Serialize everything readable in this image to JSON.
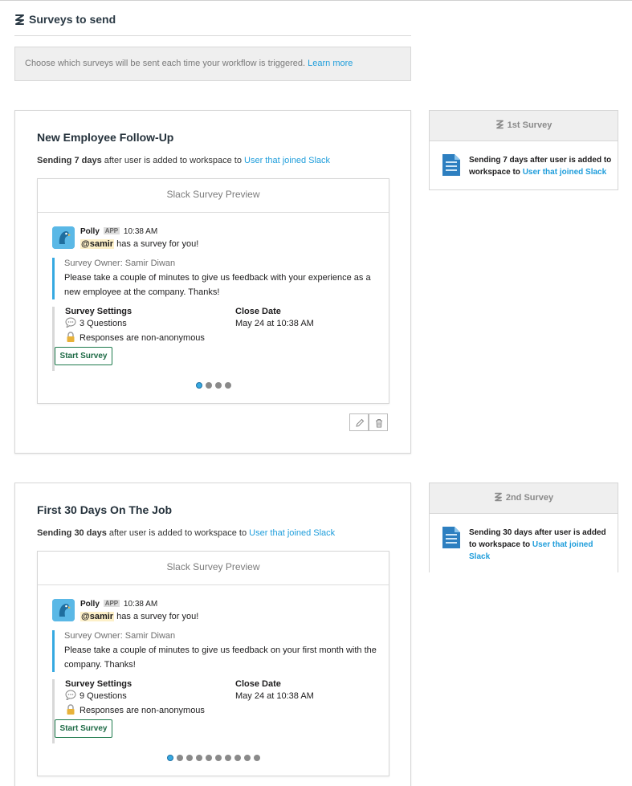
{
  "header": {
    "title": "Surveys to send",
    "icon": "polly-logo-icon"
  },
  "info": {
    "text": "Choose which surveys will be sent each time your workflow is triggered.",
    "link": "Learn more"
  },
  "cards": [
    {
      "title": "New Employee Follow-Up",
      "sending_bold": "Sending 7 days",
      "sending_rest": " after user is added to workspace to ",
      "sending_link": "User that joined Slack",
      "preview_title": "Slack Survey Preview",
      "sender": "Polly",
      "app_badge": "APP",
      "time": "10:38 AM",
      "mention": "@samir",
      "mention_rest": " has a survey for you!",
      "owner": "Survey Owner: Samir Diwan",
      "description": "Please take a couple of minutes to give us feedback with your experience as a new employee at the company. Thanks!",
      "settings_label": "Survey Settings",
      "questions": "3 Questions",
      "anonymity": "Responses are non-anonymous",
      "close_label": "Close Date",
      "close_value": "May 24 at 10:38 AM",
      "start_button": "Start Survey",
      "dots": 4
    },
    {
      "title": "First 30 Days On The Job",
      "sending_bold": "Sending 30 days",
      "sending_rest": " after user is added to workspace to ",
      "sending_link": "User that joined Slack",
      "preview_title": "Slack Survey Preview",
      "sender": "Polly",
      "app_badge": "APP",
      "time": "10:38 AM",
      "mention": "@samir",
      "mention_rest": " has a survey for you!",
      "owner": "Survey Owner: Samir Diwan",
      "description": "Please take a couple of minutes to give us feedback on your first month with the company. Thanks!",
      "settings_label": "Survey Settings",
      "questions": "9 Questions",
      "anonymity": "Responses are non-anonymous",
      "close_label": "Close Date",
      "close_value": "May 24 at 10:38 AM",
      "start_button": "Start Survey",
      "dots": 10
    }
  ],
  "side": [
    {
      "heading": "1st Survey",
      "text_bold": "Sending 7 days after user is added to workspace to ",
      "link": "User that joined Slack"
    },
    {
      "heading": "2nd Survey",
      "text_bold": "Sending 30 days after user is added to workspace to ",
      "link": "User that joined Slack"
    }
  ],
  "colors": {
    "accent": "#1e9ddb",
    "quote_bar": "#36a9e1",
    "button_green": "#1d7a4c"
  }
}
